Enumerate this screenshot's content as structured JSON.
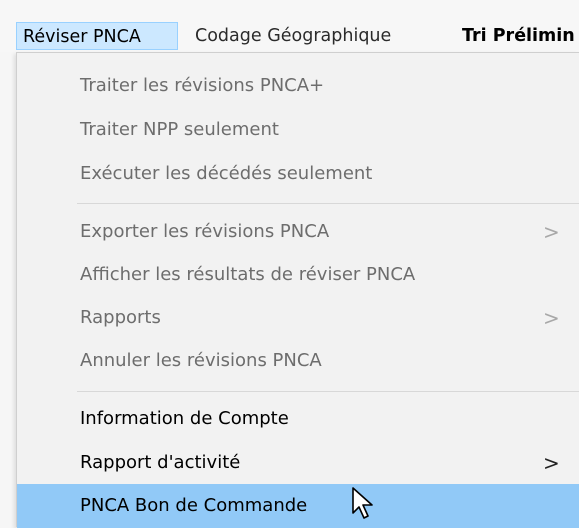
{
  "menubar": {
    "tabs": [
      {
        "label": "Réviser PNCA"
      },
      {
        "label": "Codage Géographique"
      },
      {
        "label": "Tri Prélimin"
      }
    ]
  },
  "menu": {
    "items": [
      {
        "label": "Traiter les révisions PNCA+"
      },
      {
        "label": "Traiter NPP seulement"
      },
      {
        "label": "Exécuter les décédés seulement"
      },
      {
        "label": "Exporter les révisions PNCA",
        "submenu_arrow": ">"
      },
      {
        "label": "Afficher les résultats de réviser PNCA"
      },
      {
        "label": "Rapports",
        "submenu_arrow": ">"
      },
      {
        "label": "Annuler les révisions PNCA"
      },
      {
        "label": "Information de Compte"
      },
      {
        "label": "Rapport d'activité",
        "submenu_arrow": ">"
      },
      {
        "label": "PNCA Bon de Commande"
      }
    ]
  },
  "icons": {
    "submenu": "chevron-right-icon",
    "cursor": "mouse-pointer-icon"
  },
  "colors": {
    "active_tab_bg": "#cce8ff",
    "highlight_bg": "#91c9f7",
    "disabled_text": "#6d6d6d"
  }
}
